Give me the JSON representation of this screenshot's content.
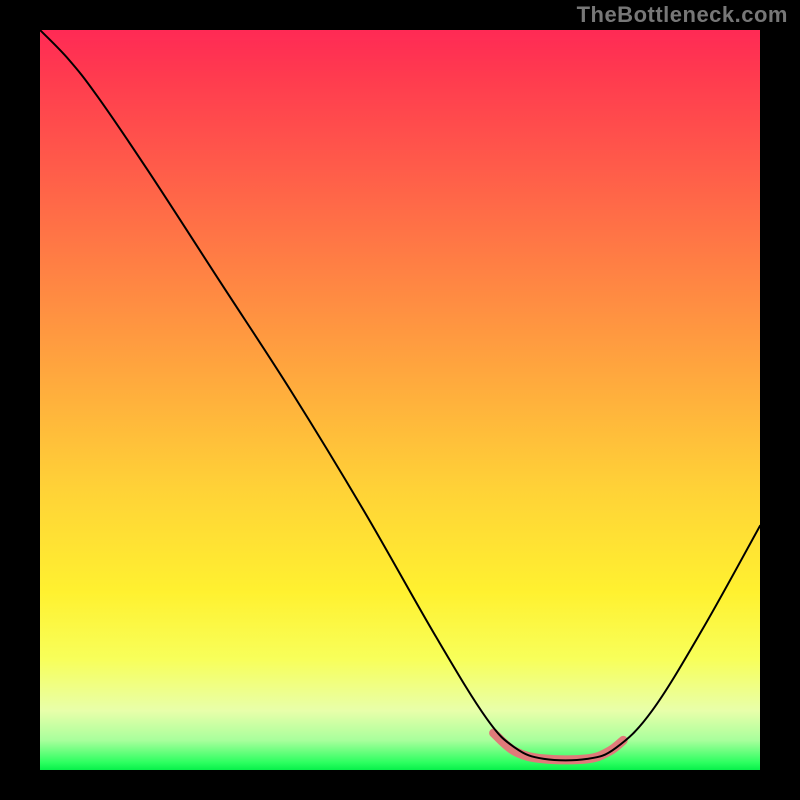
{
  "watermark_text": "TheBottleneck.com",
  "chart_data": {
    "type": "line",
    "title": "",
    "xlabel": "",
    "ylabel": "",
    "xlim": [
      0,
      100
    ],
    "ylim": [
      0,
      100
    ],
    "grid": false,
    "legend": false,
    "background_gradient": {
      "direction": "vertical",
      "stops": [
        {
          "pos": 0.0,
          "color": "#ff2a55"
        },
        {
          "pos": 0.06,
          "color": "#ff3a4f"
        },
        {
          "pos": 0.18,
          "color": "#ff5a4a"
        },
        {
          "pos": 0.32,
          "color": "#ff8044"
        },
        {
          "pos": 0.46,
          "color": "#ffa63e"
        },
        {
          "pos": 0.62,
          "color": "#ffd237"
        },
        {
          "pos": 0.76,
          "color": "#fff130"
        },
        {
          "pos": 0.85,
          "color": "#f8ff5a"
        },
        {
          "pos": 0.92,
          "color": "#e8ffaa"
        },
        {
          "pos": 0.96,
          "color": "#a8ff9c"
        },
        {
          "pos": 0.99,
          "color": "#2cff60"
        },
        {
          "pos": 1.0,
          "color": "#08f04a"
        }
      ]
    },
    "series": [
      {
        "name": "main-curve",
        "color": "#000000",
        "stroke_width": 2,
        "points": [
          {
            "x": 0,
            "y": 100
          },
          {
            "x": 4,
            "y": 96
          },
          {
            "x": 8,
            "y": 91
          },
          {
            "x": 15,
            "y": 81
          },
          {
            "x": 25,
            "y": 66
          },
          {
            "x": 35,
            "y": 51
          },
          {
            "x": 45,
            "y": 35
          },
          {
            "x": 55,
            "y": 18
          },
          {
            "x": 62,
            "y": 7
          },
          {
            "x": 66,
            "y": 3
          },
          {
            "x": 70,
            "y": 1.5
          },
          {
            "x": 76,
            "y": 1.5
          },
          {
            "x": 80,
            "y": 3
          },
          {
            "x": 85,
            "y": 8
          },
          {
            "x": 92,
            "y": 19
          },
          {
            "x": 100,
            "y": 33
          }
        ]
      },
      {
        "name": "highlight-band",
        "color": "#e07a7a",
        "stroke_width": 9,
        "points": [
          {
            "x": 63,
            "y": 5
          },
          {
            "x": 66,
            "y": 2.5
          },
          {
            "x": 70,
            "y": 1.5
          },
          {
            "x": 76,
            "y": 1.5
          },
          {
            "x": 79,
            "y": 2.5
          },
          {
            "x": 81,
            "y": 4
          }
        ]
      }
    ]
  }
}
